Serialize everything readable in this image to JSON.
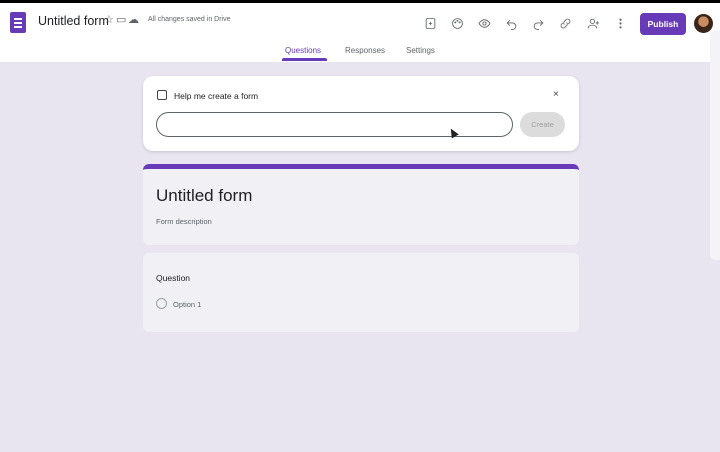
{
  "header": {
    "title": "Untitled form",
    "saved_status": "All changes saved in Drive",
    "publish_label": "Publish",
    "accent_color": "#673ab7"
  },
  "toolbar_icons": [
    "customize-icon",
    "palette-icon",
    "preview-eye-icon",
    "undo-icon",
    "redo-icon",
    "link-icon",
    "add-collaborator-icon",
    "more-vert-icon"
  ],
  "tabs": [
    {
      "label": "Questions",
      "active": true
    },
    {
      "label": "Responses",
      "active": false
    },
    {
      "label": "Settings",
      "active": false
    }
  ],
  "help_panel": {
    "title": "Help me create a form",
    "input_value": "",
    "input_placeholder": "",
    "create_label": "Create",
    "close_glyph": "×"
  },
  "form": {
    "title": "Untitled form",
    "description": "Form description"
  },
  "question": {
    "label": "Question",
    "options": [
      "Option 1"
    ]
  }
}
